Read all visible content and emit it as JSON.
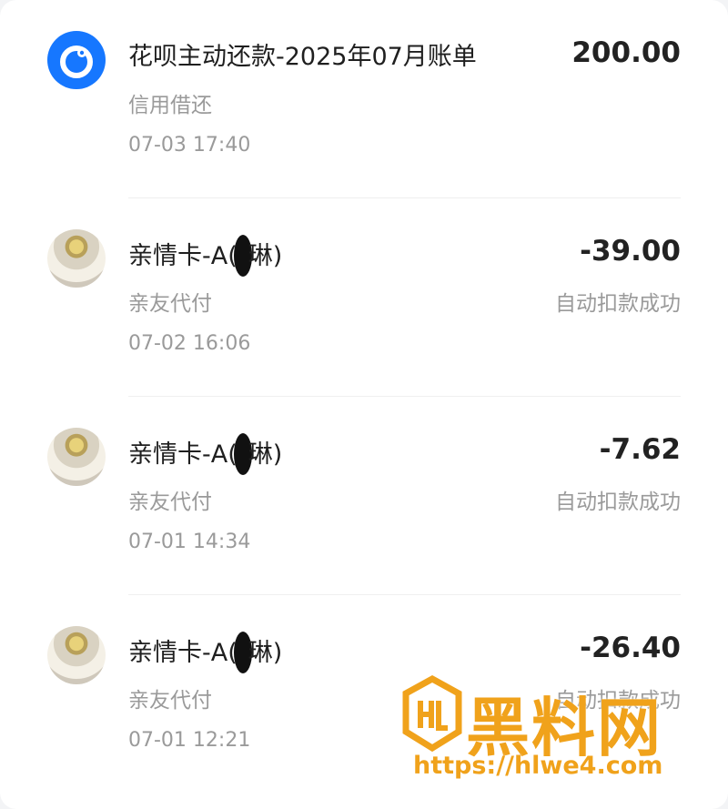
{
  "transactions": [
    {
      "title": "花呗主动还款-2025年07月账单",
      "subtitle": "信用借还",
      "time": "07-03 17:40",
      "amount": "200.00",
      "status": "",
      "avatar": "huabei-logo-icon"
    },
    {
      "title_prefix": "亲情卡-A(",
      "title_suffix": "琳)",
      "subtitle": "亲友代付",
      "time": "07-02 16:06",
      "amount": "-39.00",
      "status": "自动扣款成功",
      "avatar": "user-photo"
    },
    {
      "title_prefix": "亲情卡-A(",
      "title_suffix": "琳)",
      "subtitle": "亲友代付",
      "time": "07-01 14:34",
      "amount": "-7.62",
      "status": "自动扣款成功",
      "avatar": "user-photo"
    },
    {
      "title_prefix": "亲情卡-A(",
      "title_suffix": "琳)",
      "subtitle": "亲友代付",
      "time": "07-01 12:21",
      "amount": "-26.40",
      "status": "自动扣款成功",
      "avatar": "user-photo"
    }
  ],
  "watermark": {
    "brand": "黑料网",
    "url": "https://hlwe4.com",
    "color": "#f0a21b"
  },
  "colors": {
    "brand_blue": "#1677ff",
    "text_primary": "#1f1f1f",
    "text_secondary": "#9a9a9a"
  }
}
